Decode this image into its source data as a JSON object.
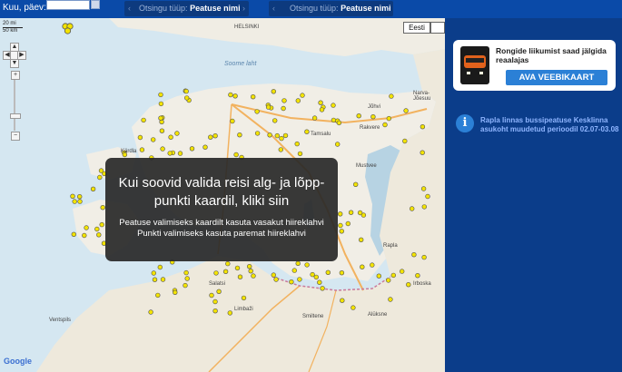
{
  "topbar": {
    "date_label": "Kuu, päev:",
    "search_type_1_label": "Otsingu tüüp:",
    "search_type_1_value": "Peatuse nimi",
    "search_type_2_label": "Otsingu tüüp:",
    "search_type_2_value": "Peatuse nimi"
  },
  "map": {
    "scale_top": "20 mi",
    "scale_bottom": "50 km",
    "map_type_terrain": "Eesti",
    "map_type_other": "",
    "google_logo": "Google",
    "labels": {
      "helsinki": "HELSINKI",
      "soome_laht": "Soome laht",
      "narva": "Narva-Jõesuu",
      "tamsalu": "Tamsalu",
      "rakvere": "Rakvere",
      "kardla": "Kärdla",
      "joeveere": "Jõhvi",
      "haapsalu": "Haapsalu",
      "parnu": "Pärnu",
      "valga": "Valga",
      "saatsi": "Salatsi",
      "limbazi": "Limbaži",
      "smiltene": "Smiltene",
      "aluksne": "Alūksne",
      "ventspils": "Ventspils",
      "irboska": "Irboska",
      "kehra": "Kehra",
      "kose": "Kose",
      "kohila": "Kohila",
      "mustvee": "Mustvee",
      "rapla": "Rapla"
    }
  },
  "overlay": {
    "title": "Kui soovid valida reisi alg- ja lõpp-punkti kaardil, kliki siin",
    "line1": "Peatuse valimiseks kaardilt kasuta vasakut hiireklahvi",
    "line2": "Punkti valimiseks kasuta paremat hiireklahvi"
  },
  "sidebar": {
    "promo_text": "Rongide liikumist saad jälgida reaalajas",
    "promo_button": "AVA VEEBIKAART",
    "notice_text": "Rapla linnas bussipeatuse Kesklinna asukoht muudetud perioodil 02.07-03.08"
  },
  "colors": {
    "topbar_bg": "#0a4aa8",
    "sidebar_bg": "#0b3d8a",
    "button_bg": "#2b80d6",
    "stop_marker": "#f3e300"
  }
}
